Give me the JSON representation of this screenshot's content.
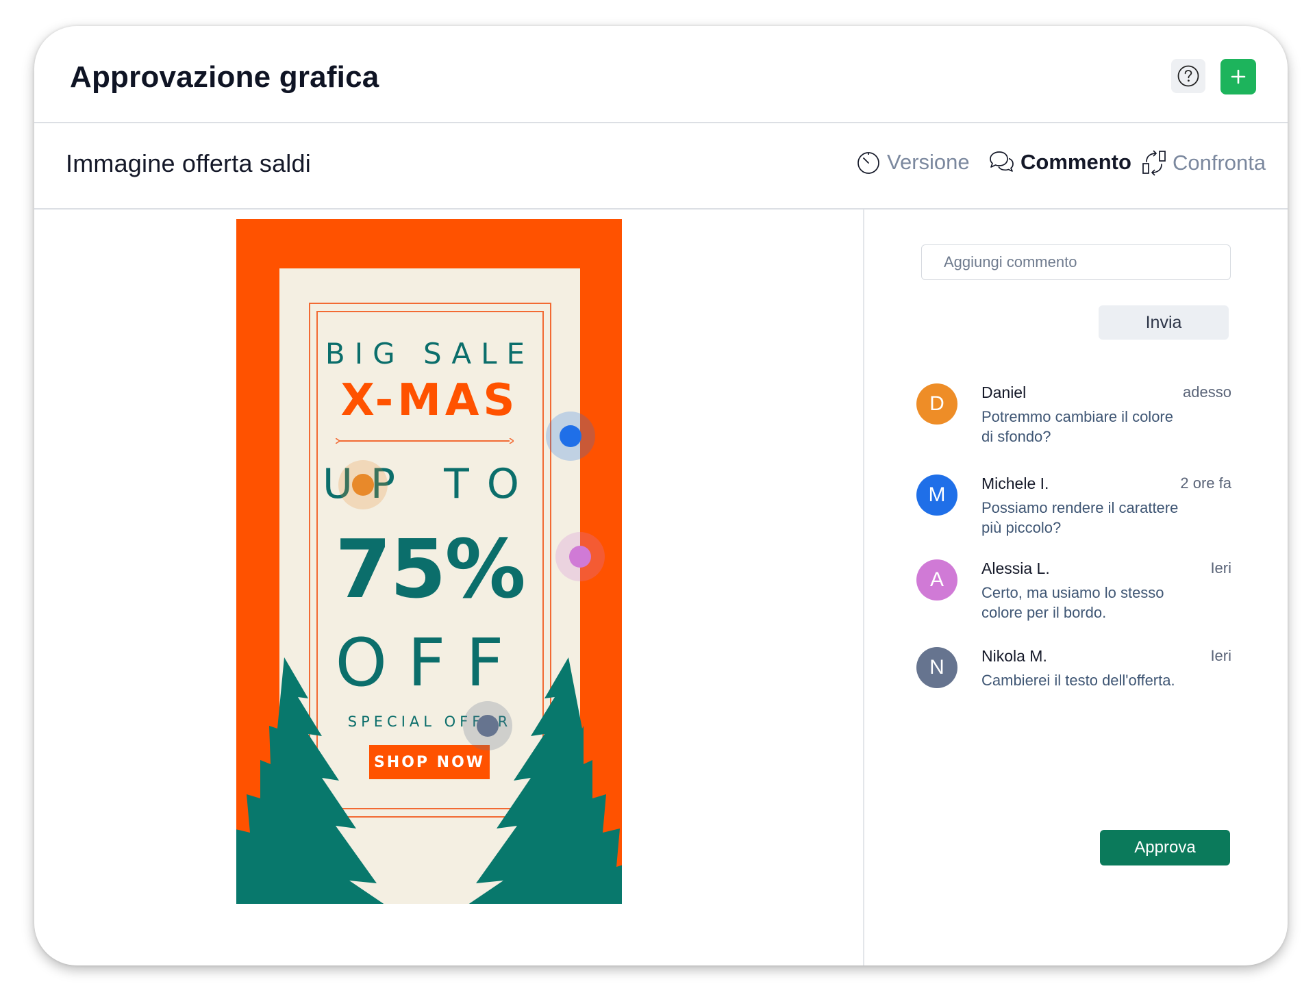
{
  "header": {
    "title": "Approvazione grafica",
    "help_icon": "question-circle-icon",
    "add_icon": "plus-icon",
    "add_color": "#1db45c"
  },
  "subheader": {
    "title": "Immagine offerta saldi",
    "tabs": [
      {
        "label": "Versione",
        "icon": "clock-icon",
        "active": false
      },
      {
        "label": "Commento",
        "icon": "chat-bubbles-icon",
        "active": true
      },
      {
        "label": "Confronta",
        "icon": "compare-arrows-icon",
        "active": false
      }
    ]
  },
  "poster": {
    "line1": "BIG SALE",
    "line2": "X-MAS",
    "line3": "UP TO",
    "line4": "75%",
    "line5": "OFF",
    "line6": "SPECIAL OFFER",
    "cta": "SHOP NOW",
    "colors": {
      "orange": "#ff5200",
      "teal": "#0b6e6b",
      "cream": "#f4efe2"
    }
  },
  "markers": [
    {
      "author": "Daniel",
      "color": "#e8892a"
    },
    {
      "author": "Michele I.",
      "color": "#1f6fe8"
    },
    {
      "author": "Alessia L.",
      "color": "#d07ad6"
    },
    {
      "author": "Nikola M.",
      "color": "#66748f"
    }
  ],
  "comment_form": {
    "placeholder": "Aggiungi commento",
    "send_label": "Invia"
  },
  "comments": [
    {
      "initial": "D",
      "name": "Daniel",
      "time": "adesso",
      "text": "Potremmo cambiare il colore di sfondo?",
      "color": "#ee8d27"
    },
    {
      "initial": "M",
      "name": "Michele I.",
      "time": "2 ore fa",
      "text": "Possiamo rendere il carattere più piccolo?",
      "color": "#1f6fe8"
    },
    {
      "initial": "A",
      "name": "Alessia L.",
      "time": "Ieri",
      "text": "Certo, ma usiamo lo stesso colore per il bordo.",
      "color": "#d07ad6"
    },
    {
      "initial": "N",
      "name": "Nikola M.",
      "time": "Ieri",
      "text": "Cambierei il testo dell'offerta.",
      "color": "#66748f"
    }
  ],
  "approve_label": "Approva"
}
